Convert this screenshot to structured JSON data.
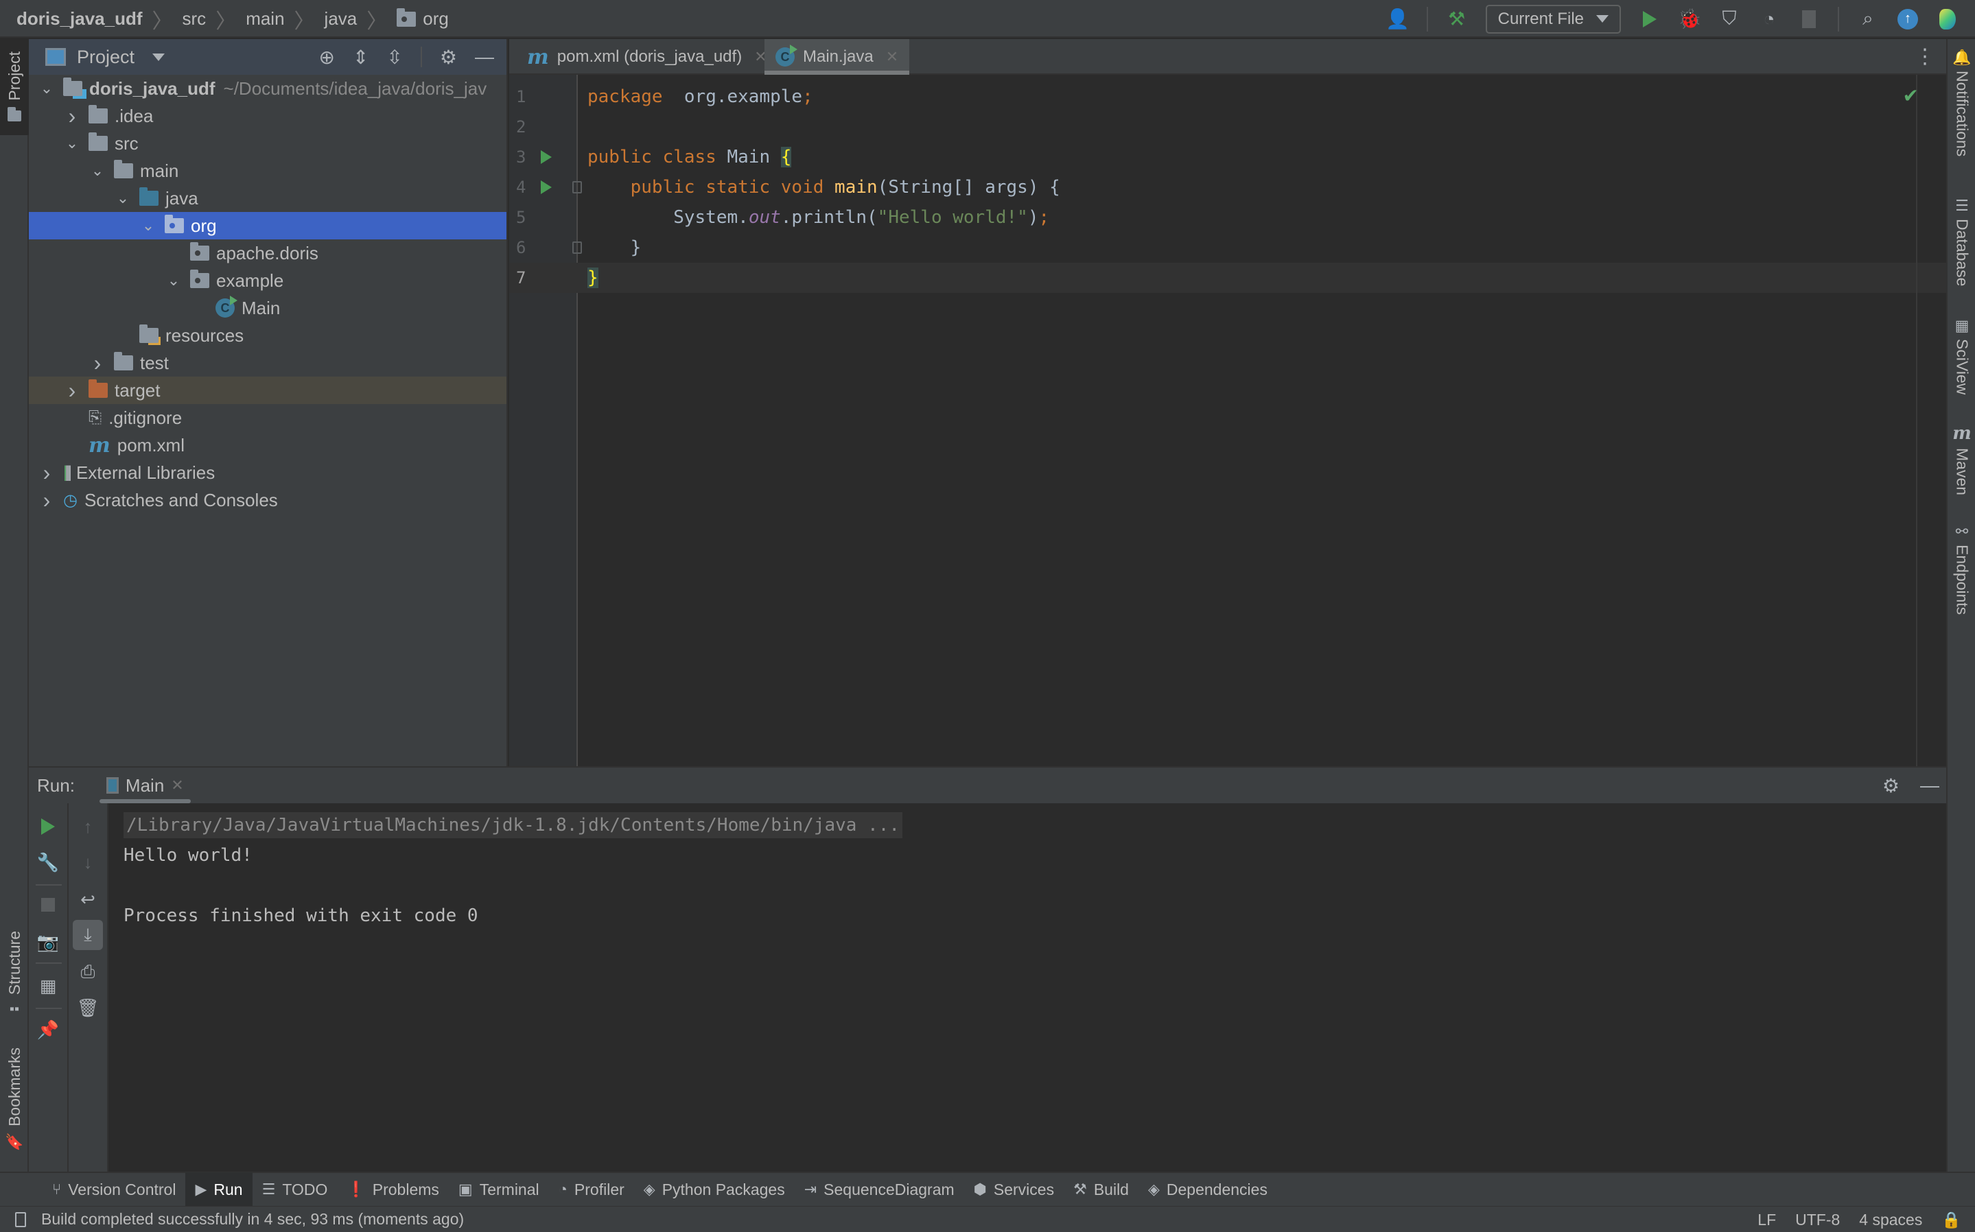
{
  "navbar": {
    "breadcrumbs": [
      "doris_java_udf",
      "src",
      "main",
      "java",
      "org"
    ],
    "run_config": "Current File"
  },
  "left_strip": {
    "tabs": [
      {
        "label": "Project",
        "icon": "folder-icon",
        "active": true
      },
      {
        "label": "Structure",
        "icon": "structure-icon"
      },
      {
        "label": "Bookmarks",
        "icon": "bookmark-icon"
      }
    ]
  },
  "project_panel": {
    "title": "Project",
    "tree": [
      {
        "label": "doris_java_udf",
        "hint": "~/Documents/idea_java/doris_jav",
        "depth": 0,
        "state": "expanded",
        "icon": "module-folder-icon",
        "bold": true
      },
      {
        "label": ".idea",
        "depth": 1,
        "state": "collapsed",
        "icon": "folder-icon"
      },
      {
        "label": "src",
        "depth": 1,
        "state": "expanded",
        "icon": "folder-icon"
      },
      {
        "label": "main",
        "depth": 2,
        "state": "expanded",
        "icon": "folder-icon"
      },
      {
        "label": "java",
        "depth": 3,
        "state": "expanded",
        "icon": "source-folder-icon"
      },
      {
        "label": "org",
        "depth": 4,
        "state": "expanded",
        "icon": "package-icon",
        "selected": true
      },
      {
        "label": "apache.doris",
        "depth": 5,
        "state": "leaf",
        "icon": "package-icon"
      },
      {
        "label": "example",
        "depth": 5,
        "state": "expanded",
        "icon": "package-icon"
      },
      {
        "label": "Main",
        "depth": 6,
        "state": "leaf",
        "icon": "java-class-icon"
      },
      {
        "label": "resources",
        "depth": 3,
        "state": "leaf",
        "icon": "resources-folder-icon"
      },
      {
        "label": "test",
        "depth": 2,
        "state": "collapsed",
        "icon": "folder-icon"
      },
      {
        "label": "target",
        "depth": 1,
        "state": "collapsed",
        "icon": "excluded-folder-icon",
        "excluded": true
      },
      {
        "label": ".gitignore",
        "depth": 1,
        "state": "leaf",
        "icon": "ignore-file-icon"
      },
      {
        "label": "pom.xml",
        "depth": 1,
        "state": "leaf",
        "icon": "maven-icon"
      },
      {
        "label": "External Libraries",
        "depth": 0,
        "state": "collapsed",
        "icon": "libraries-icon"
      },
      {
        "label": "Scratches and Consoles",
        "depth": 0,
        "state": "collapsed",
        "icon": "scratches-icon"
      }
    ]
  },
  "editor": {
    "tabs": [
      {
        "label": "pom.xml (doris_java_udf)",
        "icon": "maven-icon",
        "active": false
      },
      {
        "label": "Main.java",
        "icon": "java-class-icon",
        "active": true
      }
    ],
    "lines": [
      {
        "n": "1",
        "tokens": [
          [
            "kw",
            "package"
          ],
          [
            "",
            "  org.example"
          ],
          [
            "kw",
            ";"
          ]
        ]
      },
      {
        "n": "2",
        "tokens": []
      },
      {
        "n": "3",
        "run": true,
        "tokens": [
          [
            "kw",
            "public class "
          ],
          [
            "",
            "Main "
          ],
          [
            "brace",
            "{"
          ]
        ]
      },
      {
        "n": "4",
        "run": true,
        "fold": true,
        "tokens": [
          [
            "",
            "    "
          ],
          [
            "kw",
            "public static void "
          ],
          [
            "fn",
            "main"
          ],
          [
            "",
            "(String[] args) {"
          ]
        ]
      },
      {
        "n": "5",
        "tokens": [
          [
            "",
            "        System."
          ],
          [
            "field",
            "out"
          ],
          [
            "",
            ".println("
          ],
          [
            "str",
            "\"Hello world!\""
          ],
          [
            "",
            ")"
          ],
          [
            "kw",
            ";"
          ]
        ]
      },
      {
        "n": "6",
        "fold": true,
        "tokens": [
          [
            "",
            "    }"
          ]
        ]
      },
      {
        "n": "7",
        "current": true,
        "tokens": [
          [
            "brace",
            "}"
          ]
        ]
      }
    ]
  },
  "right_strip": {
    "tabs": [
      "Notifications",
      "Database",
      "SciView",
      "Maven",
      "Endpoints"
    ]
  },
  "run_panel": {
    "label": "Run:",
    "tab": "Main",
    "console": [
      "/Library/Java/JavaVirtualMachines/jdk-1.8.jdk/Contents/Home/bin/java ...",
      "Hello world!",
      "",
      "Process finished with exit code 0"
    ]
  },
  "bottom_tools": [
    {
      "label": "Version Control",
      "icon": "vcs-icon"
    },
    {
      "label": "Run",
      "icon": "run-icon",
      "active": true
    },
    {
      "label": "TODO",
      "icon": "todo-icon"
    },
    {
      "label": "Problems",
      "icon": "problems-icon"
    },
    {
      "label": "Terminal",
      "icon": "terminal-icon"
    },
    {
      "label": "Profiler",
      "icon": "profiler-icon"
    },
    {
      "label": "Python Packages",
      "icon": "packages-icon"
    },
    {
      "label": "SequenceDiagram",
      "icon": "sequence-icon"
    },
    {
      "label": "Services",
      "icon": "services-icon"
    },
    {
      "label": "Build",
      "icon": "build-icon"
    },
    {
      "label": "Dependencies",
      "icon": "dependencies-icon"
    }
  ],
  "statusbar": {
    "message": "Build completed successfully in 4 sec, 93 ms (moments ago)",
    "line_ending": "LF",
    "encoding": "UTF-8",
    "indent": "4 spaces"
  },
  "colors": {
    "selection": "#3d63c4",
    "run_green": "#499c54",
    "keyword": "#cc7832",
    "string": "#6a8759",
    "function": "#ffc66d",
    "field": "#9876aa"
  }
}
